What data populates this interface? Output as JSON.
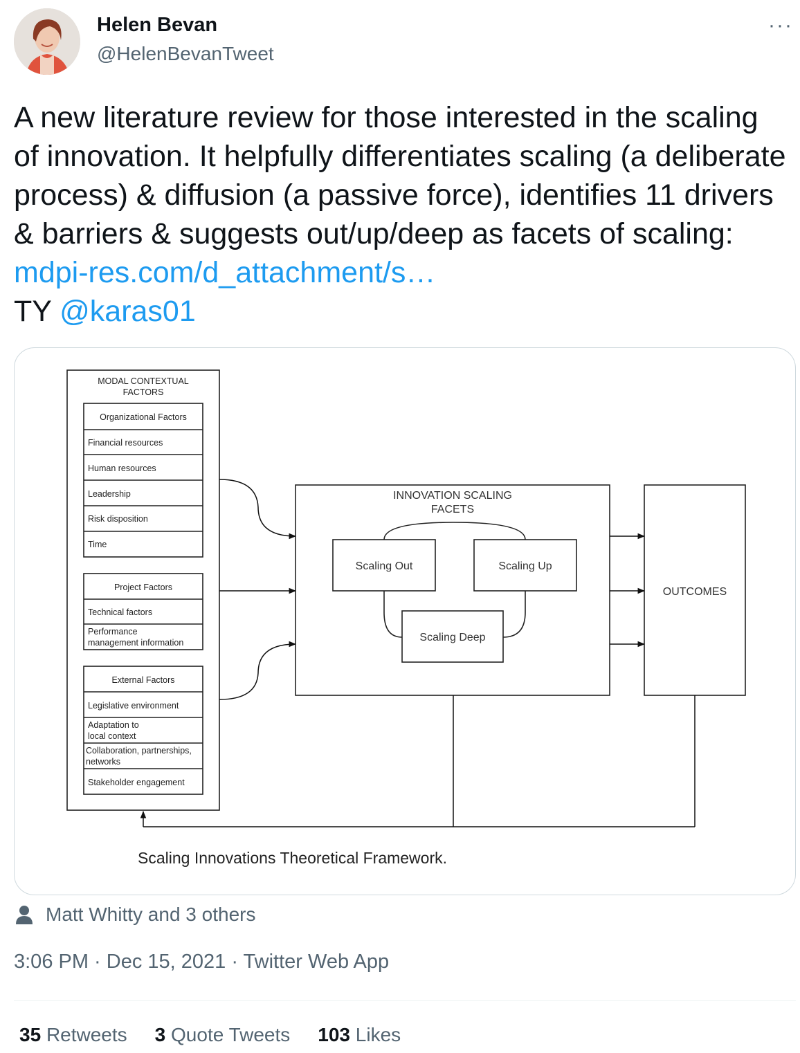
{
  "author": {
    "name": "Helen Bevan",
    "handle": "@HelenBevanTweet"
  },
  "more_label": "···",
  "tweet": {
    "text_main": "A new literature review for those interested in the scaling of innovation. It helpfully differentiates scaling (a deliberate process) & diffusion (a passive force), identifies 11 drivers & barriers & suggests out/up/deep as facets of scaling: ",
    "link_text": "mdpi-res.com/d_attachment/s…",
    "ty_text": "TY ",
    "mention": "@karas01"
  },
  "diagram": {
    "modal_title_1": "MODAL CONTEXTUAL",
    "modal_title_2": "FACTORS",
    "org_header": "Organizational Factors",
    "org_items": [
      "Financial resources",
      "Human resources",
      "Leadership",
      "Risk disposition",
      "Time"
    ],
    "project_header": "Project Factors",
    "project_items": [
      "Technical factors",
      "Performance",
      "management information"
    ],
    "external_header": "External Factors",
    "external_items": [
      "Legislative environment",
      "Adaptation to",
      "local context",
      "Collaboration, partnerships,",
      "networks",
      "Stakeholder engagement"
    ],
    "facets_title_1": "INNOVATION SCALING",
    "facets_title_2": "FACETS",
    "scaling_out": "Scaling Out",
    "scaling_up": "Scaling Up",
    "scaling_deep": "Scaling Deep",
    "outcomes": "OUTCOMES",
    "caption": "Scaling Innovations Theoretical Framework."
  },
  "engagement": {
    "liked_by": "Matt Whitty and 3 others",
    "timestamp": "3:06 PM · Dec 15, 2021 · Twitter Web App",
    "retweets_count": "35",
    "retweets_label": "Retweets",
    "quotes_count": "3",
    "quotes_label": "Quote Tweets",
    "likes_count": "103",
    "likes_label": "Likes"
  }
}
